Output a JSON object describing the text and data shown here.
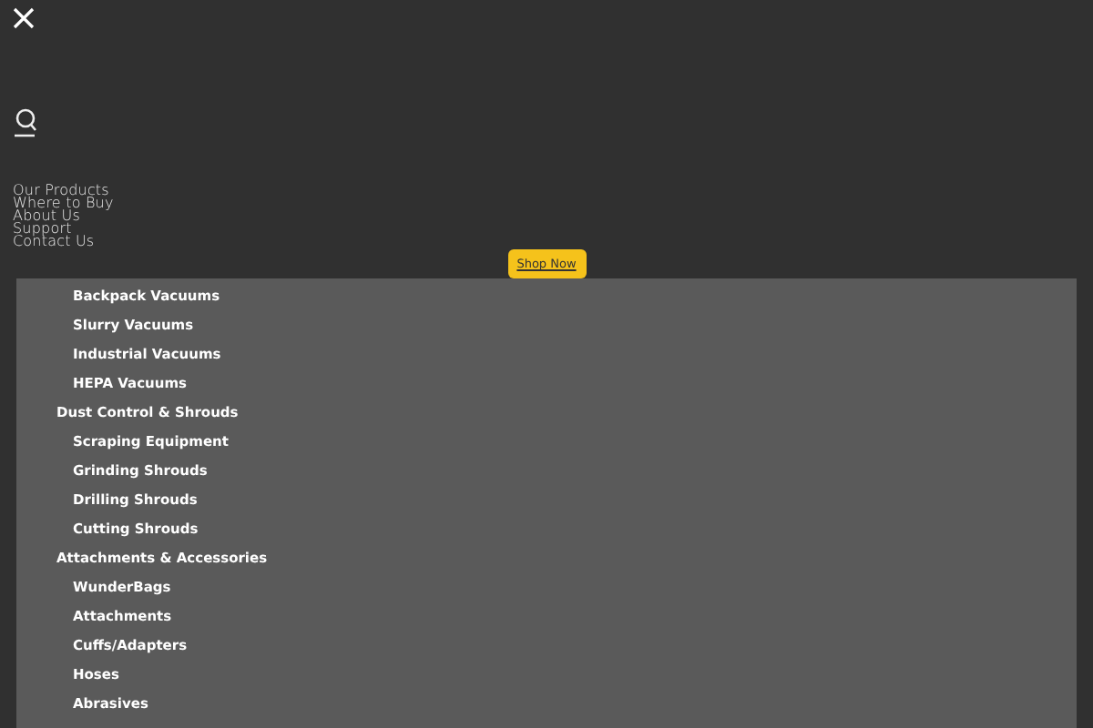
{
  "nav_links": [
    "Our Products",
    "Where to Buy",
    "About Us",
    "Support",
    "Contact Us"
  ],
  "shop_button": "Shop Now",
  "menu": [
    {
      "children": [
        "Backpack Vacuums",
        "Slurry Vacuums",
        "Industrial Vacuums",
        "HEPA Vacuums"
      ]
    },
    {
      "label": "Dust Control & Shrouds",
      "children": [
        "Scraping Equipment",
        "Grinding Shrouds",
        "Drilling Shrouds",
        "Cutting Shrouds"
      ]
    },
    {
      "label": "Attachments & Accessories",
      "children": [
        "WunderBags",
        "Attachments",
        "Cuffs/Adapters",
        "Hoses",
        "Abrasives"
      ]
    }
  ]
}
